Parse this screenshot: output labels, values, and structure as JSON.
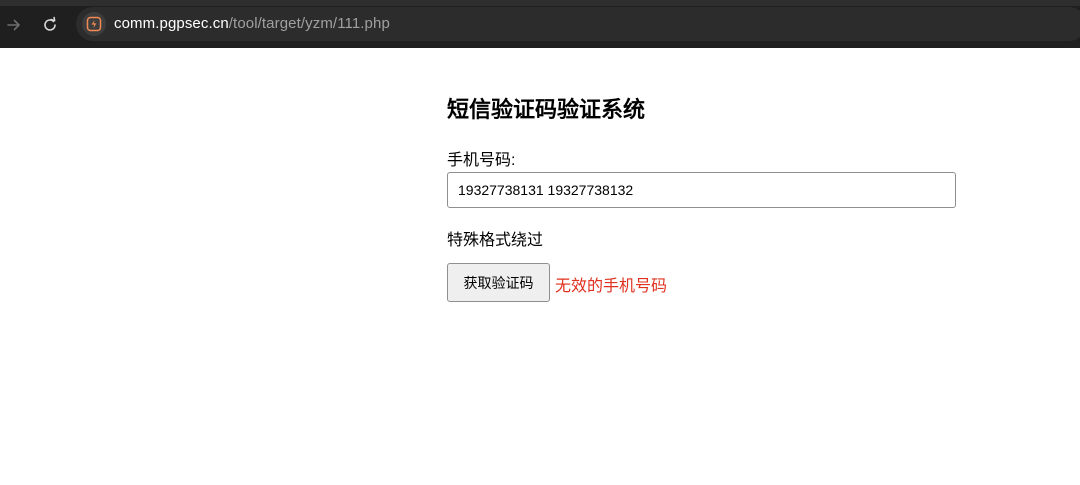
{
  "browser": {
    "url_host": "comm.pgpsec.cn",
    "url_path": "/tool/target/yzm/111.php",
    "icons": {
      "forward": "arrow-right-icon",
      "reload": "reload-icon",
      "site": "site-info-icon"
    }
  },
  "page": {
    "title": "短信验证码验证系统",
    "phone_label": "手机号码:",
    "phone_value": "19327738131 19327738132",
    "bypass_text": "特殊格式绕过",
    "get_code_button": "获取验证码",
    "error_message": "无效的手机号码",
    "error_color": "#e0301e"
  }
}
